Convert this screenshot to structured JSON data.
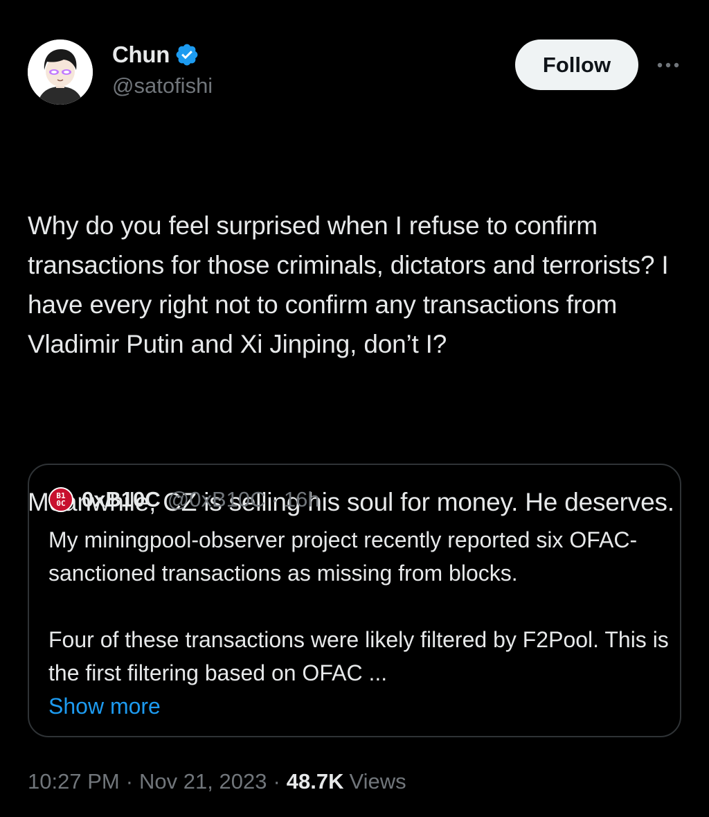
{
  "author": {
    "display_name": "Chun",
    "handle": "@satofishi",
    "verified": true
  },
  "actions": {
    "follow_label": "Follow",
    "more_icon": "more-horizontal-icon"
  },
  "tweet": {
    "paragraphs": [
      "Why do you feel surprised when I refuse to confirm transactions for those criminals, dictators and terrorists? I have every right not to confirm any transactions from Vladimir Putin and Xi Jinping, don’t I?",
      "Meanwhile, CZ is selling his soul for money. He deserves."
    ]
  },
  "quote": {
    "avatar_text_top": "B1",
    "avatar_text_bottom": "0C",
    "display_name": "0xB10C",
    "handle": "@0xB10C",
    "separator": "·",
    "time": "16h",
    "paragraphs": [
      "My miningpool-observer project recently reported six OFAC-sanctioned transactions as missing from blocks.",
      "Four of these transactions were likely filtered by F2Pool. This is the first filtering based on OFAC ..."
    ],
    "show_more_label": "Show more"
  },
  "meta": {
    "time": "10:27 PM",
    "separator": "·",
    "date": "Nov 21, 2023",
    "views_count": "48.7K",
    "views_label": "Views"
  },
  "colors": {
    "background": "#000000",
    "text_primary": "#e7e9ea",
    "text_secondary": "#71767b",
    "accent": "#1d9bf0",
    "border": "#2f3336",
    "follow_bg": "#eff3f4",
    "quote_avatar_bg": "#c8102e"
  }
}
